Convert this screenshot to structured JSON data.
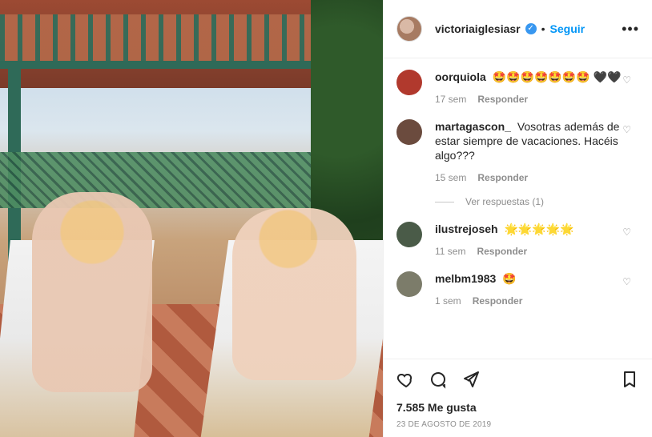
{
  "post": {
    "image_alt": "",
    "header": {
      "username": "victoriaiglesiasr",
      "dot": "•",
      "follow_label": "Seguir",
      "more_label": "•••"
    },
    "comments": [
      {
        "username": "oorquiola",
        "text": "🤩🤩🤩🤩🤩🤩🤩 🖤🖤",
        "time": "17 sem",
        "reply_label": "Responder",
        "avatar_color": "#c0392b"
      },
      {
        "username": "martagascon_",
        "text": "Vosotras además de estar siempre de vacaciones. Hacéis algo???",
        "time": "15 sem",
        "reply_label": "Responder",
        "avatar_color": "#6b4b3e"
      },
      {
        "username": "ilustrejoseh",
        "text": "🌟🌟🌟🌟🌟",
        "time": "11 sem",
        "reply_label": "Responder",
        "avatar_color": "#4a5b48"
      },
      {
        "username": "melbm1983",
        "text": "🤩",
        "time": "1 sem",
        "reply_label": "Responder",
        "avatar_color": "#7c7c6a"
      }
    ],
    "view_replies_label": "Ver respuestas (1)",
    "likes_text": "7.585 Me gusta",
    "date_text": "23 DE AGOSTO DE 2019",
    "icons": {
      "like": "heart-icon",
      "comment": "comment-icon",
      "share": "share-icon",
      "save": "bookmark-icon",
      "verified": "verified-icon",
      "more": "more-icon",
      "comment_like": "heart-icon"
    }
  }
}
